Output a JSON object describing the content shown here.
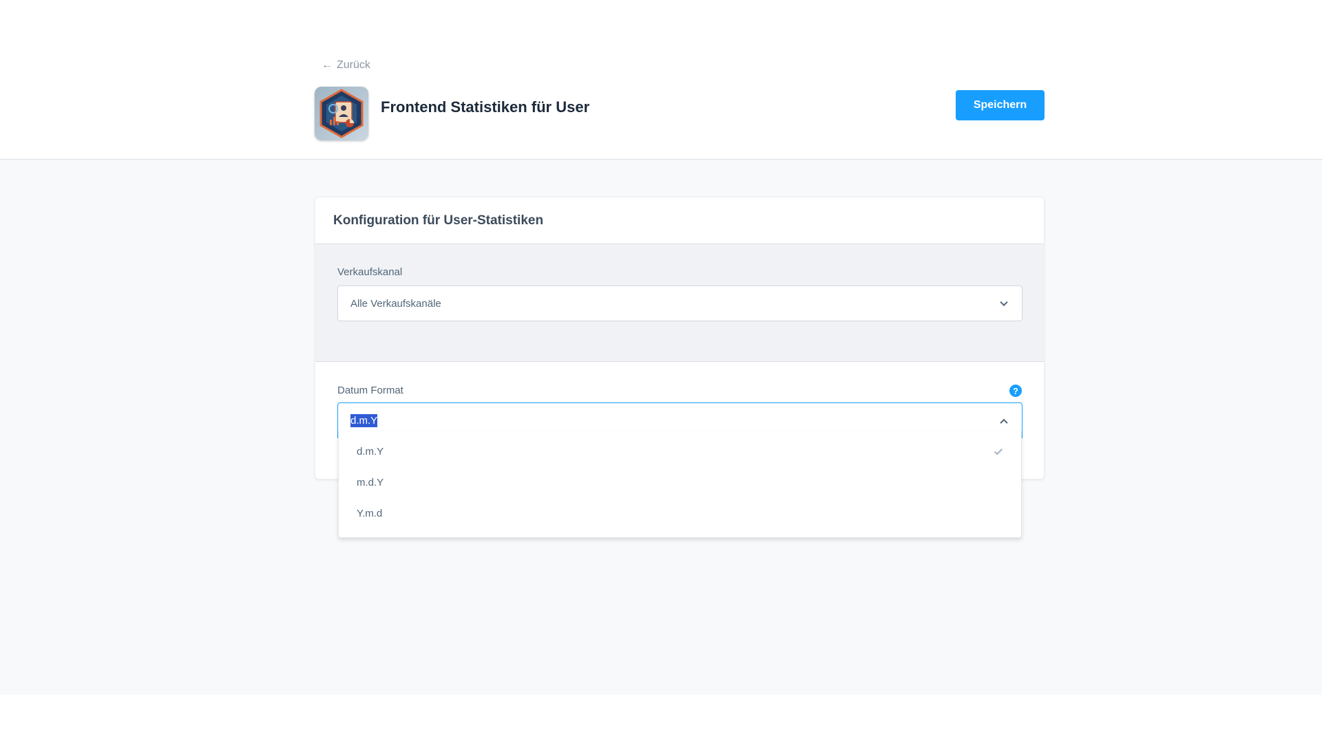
{
  "header": {
    "back_label": "Zurück",
    "back_arrow": "←",
    "app_icon": "statistics-app-icon",
    "app_title": "Frontend Statistiken für User",
    "save_label": "Speichern",
    "accent_color": "#189eff"
  },
  "card": {
    "title": "Konfiguration für User-Statistiken",
    "sales_channel": {
      "label": "Verkaufskanal",
      "value": "Alle Verkaufskanäle"
    },
    "date_format": {
      "label": "Datum Format",
      "help_icon": "?",
      "value": "d.m.Y",
      "options": [
        {
          "label": "d.m.Y",
          "selected": true
        },
        {
          "label": "m.d.Y",
          "selected": false
        },
        {
          "label": "Y.m.d",
          "selected": false
        }
      ]
    }
  }
}
